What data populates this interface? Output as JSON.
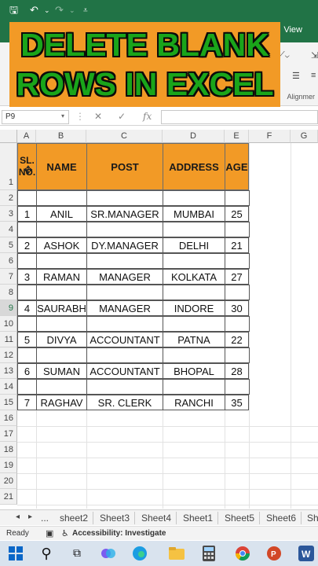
{
  "ribbon": {
    "view_tab": "View",
    "alignment_label": "Alignmer"
  },
  "banner": {
    "line1": "DELETE BLANK",
    "line2": "ROWS IN EXCEL"
  },
  "formula": {
    "namebox": "P9",
    "cancel": "✕",
    "enter": "✓",
    "fx": "fx"
  },
  "columns": [
    "A",
    "B",
    "C",
    "D",
    "E",
    "F",
    "G"
  ],
  "rows": [
    "1",
    "2",
    "3",
    "4",
    "5",
    "6",
    "7",
    "8",
    "9",
    "10",
    "11",
    "12",
    "13",
    "14",
    "15",
    "16",
    "17",
    "18",
    "19",
    "20",
    "21"
  ],
  "headers": {
    "slno": "SL. NO.",
    "name": "NAME",
    "post": "POST",
    "address": "ADDRESS",
    "age": "AGE"
  },
  "records": [
    {
      "sl": "1",
      "name": "ANIL",
      "post": "SR.MANAGER",
      "address": "MUMBAI",
      "age": "25"
    },
    {
      "sl": "2",
      "name": "ASHOK",
      "post": "DY.MANAGER",
      "address": "DELHI",
      "age": "21"
    },
    {
      "sl": "3",
      "name": "RAMAN",
      "post": "MANAGER",
      "address": "KOLKATA",
      "age": "27"
    },
    {
      "sl": "4",
      "name": "SAURABH",
      "post": "MANAGER",
      "address": "INDORE",
      "age": "30"
    },
    {
      "sl": "5",
      "name": "DIVYA",
      "post": "ACCOUNTANT",
      "address": "PATNA",
      "age": "22"
    },
    {
      "sl": "6",
      "name": "SUMAN",
      "post": "ACCOUNTANT",
      "address": "BHOPAL",
      "age": "28"
    },
    {
      "sl": "7",
      "name": "RAGHAV",
      "post": "SR. CLERK",
      "address": "RANCHI",
      "age": "35"
    }
  ],
  "sheets": {
    "ellipsis": "...",
    "tabs": [
      "sheet2",
      "Sheet3",
      "Sheet4",
      "Sheet1",
      "Sheet5",
      "Sheet6",
      "Sh"
    ]
  },
  "status": {
    "ready": "Ready",
    "accessibility": "Accessibility: Investigate"
  },
  "colors": {
    "excel_green": "#217346",
    "header_orange": "#f29a26",
    "banner_text": "#1aa51a"
  }
}
